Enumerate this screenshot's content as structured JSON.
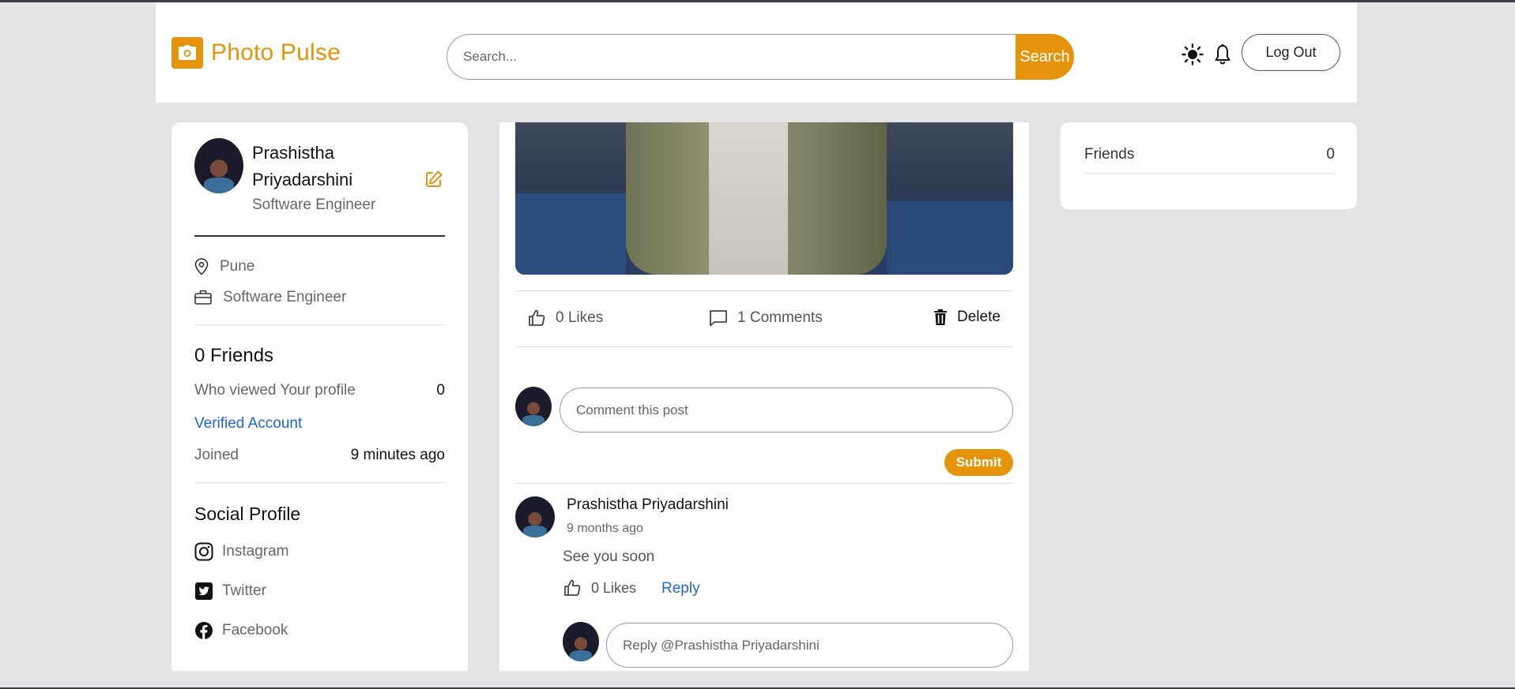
{
  "header": {
    "logo_text": "Photo Pulse",
    "search_placeholder": "Search...",
    "search_button": "Search",
    "logout": "Log Out"
  },
  "profile": {
    "name": "Prashistha Priyadarshini",
    "title": "Software Engineer",
    "location": "Pune",
    "occupation": "Software Engineer",
    "friends_heading": "0 Friends",
    "viewed_label": "Who viewed Your profile",
    "viewed_value": "0",
    "verified": "Verified Account",
    "joined_label": "Joined",
    "joined_value": "9 minutes ago",
    "social_heading": "Social Profile",
    "social": [
      "Instagram",
      "Twitter",
      "Facebook"
    ]
  },
  "post": {
    "likes": "0 Likes",
    "comments": "1 Comments",
    "delete": "Delete",
    "comment_placeholder": "Comment this post",
    "submit": "Submit"
  },
  "comment": {
    "author": "Prashistha Priyadarshini",
    "time": "9 months ago",
    "text": "See you soon",
    "likes": "0 Likes",
    "reply": "Reply",
    "reply_placeholder": "Reply @Prashistha Priyadarshini"
  },
  "sidebar_right": {
    "friends_label": "Friends",
    "friends_count": "0"
  },
  "colors": {
    "accent": "#e5930b",
    "link": "#1d64d6",
    "background": "#e3e3e3"
  }
}
